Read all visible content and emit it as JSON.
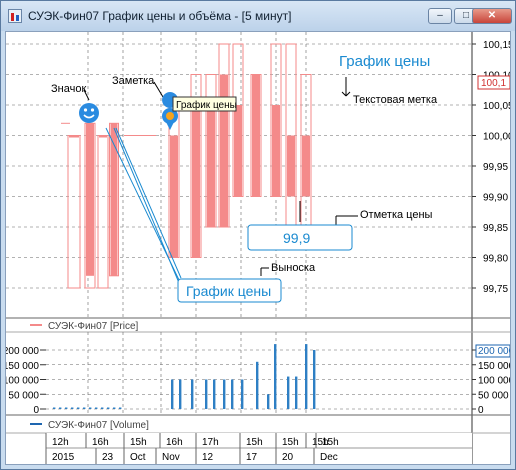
{
  "window": {
    "title": "СУЭК-Фин07 График цены и объёма - [5 минут]",
    "minimize": "–",
    "maximize": "□",
    "close": "✕"
  },
  "price_axis": {
    "ticks": [
      "100,15",
      "100,10",
      "100,05",
      "100,00",
      "99,95",
      "99,90",
      "99,85",
      "99,80",
      "99,75"
    ],
    "current_marker": "100,1"
  },
  "volume_axis": {
    "ticks": [
      "200 000",
      "150 000",
      "100 000",
      "50 000",
      "0"
    ],
    "current_marker": "200 000"
  },
  "annotations": {
    "icon_label": "Значок",
    "note_label": "Заметка",
    "note_tooltip": "График цены",
    "chart_title_text": "График цены",
    "text_label": "Текстовая метка",
    "price_mark_label": "Отметка цены",
    "price_mark_value": "99,9",
    "callout_label": "Выноска",
    "callout_text": "График цены"
  },
  "legends": {
    "price": "СУЭК-Фин07 [Price]",
    "volume": "СУЭК-Фин07 [Volume]"
  },
  "time_axis": {
    "row1": [
      "12h",
      "16h",
      "15h",
      "16h",
      "17h",
      "15h",
      "15h",
      "15h",
      "15h"
    ],
    "row2": [
      "2015",
      "23",
      "Oct",
      "Nov",
      "12",
      "17",
      "20",
      "Dec"
    ]
  },
  "colors": {
    "price_bar": "#f48a8a",
    "volume_bar": "#2e7fc4",
    "axis_marker_price": "#d03030",
    "axis_marker_volume": "#1e66b0",
    "annotation": "#1a8ad0"
  },
  "chart_data": [
    {
      "type": "bar",
      "title": "",
      "series": [
        {
          "name": "СУЭК-Фин07 [Price]",
          "description": "candles (open/close body with high/low wicks)"
        }
      ],
      "candles": [
        {
          "low": 99.75,
          "high": 100.0,
          "open": 100.0,
          "close": 100.0
        },
        {
          "low": 99.75,
          "high": 100.02,
          "open": 100.02,
          "close": 99.77
        },
        {
          "low": 99.75,
          "high": 100.0,
          "open": 100.0,
          "close": 100.0
        },
        {
          "low": 99.77,
          "high": 100.02,
          "open": 100.02,
          "close": 99.77
        },
        {
          "low": 99.8,
          "high": 100.05,
          "open": 100.0,
          "close": 99.8
        },
        {
          "low": 99.8,
          "high": 100.1,
          "open": 100.05,
          "close": 99.8
        },
        {
          "low": 99.85,
          "high": 100.1,
          "open": 100.05,
          "close": 99.85
        },
        {
          "low": 99.85,
          "high": 100.15,
          "open": 100.1,
          "close": 99.85
        },
        {
          "low": 99.9,
          "high": 100.15,
          "open": 100.05,
          "close": 99.9
        },
        {
          "low": 99.9,
          "high": 100.1,
          "open": 100.1,
          "close": 99.9
        },
        {
          "low": 99.9,
          "high": 100.15,
          "open": 100.05,
          "close": 99.9
        },
        {
          "low": 99.85,
          "high": 100.15,
          "open": 100.0,
          "close": 99.9
        },
        {
          "low": 99.85,
          "high": 100.1,
          "open": 100.0,
          "close": 99.9
        }
      ],
      "ylim": [
        99.72,
        100.18
      ]
    },
    {
      "type": "bar",
      "series": [
        {
          "name": "СУЭК-Фин07 [Volume]"
        }
      ],
      "values": [
        0,
        0,
        0,
        0,
        0,
        0,
        0,
        0,
        0,
        0,
        0,
        0,
        100000,
        100000,
        100000,
        100000,
        100000,
        100000,
        100000,
        100000,
        160000,
        50000,
        220000,
        110000,
        110000,
        220000,
        200000
      ],
      "ylim": [
        0,
        220000
      ]
    }
  ]
}
